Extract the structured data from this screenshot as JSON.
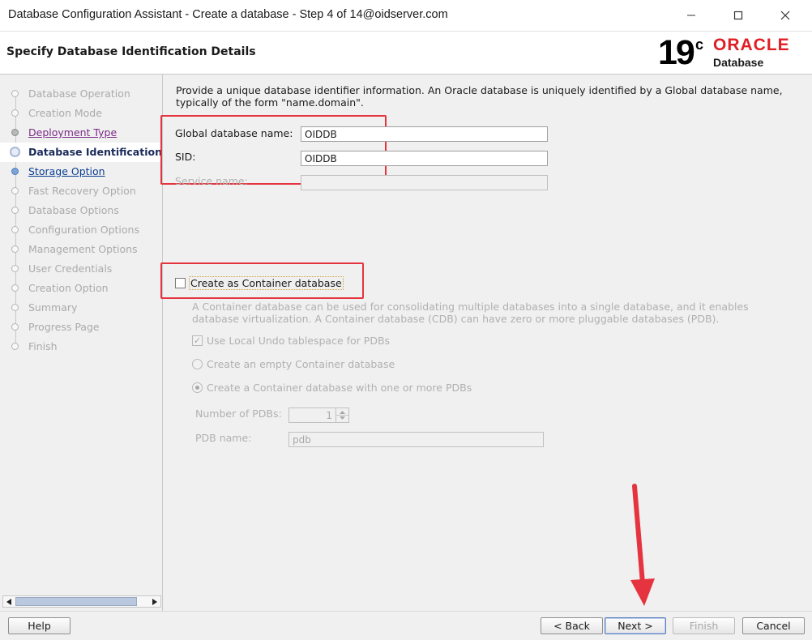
{
  "window": {
    "title": "Database Configuration Assistant - Create a database - Step 4 of 14@oidserver.com",
    "minimize_glyph": "—",
    "maximize_glyph": "☐",
    "close_glyph": "✕"
  },
  "header": {
    "page_title": "Specify Database Identification Details",
    "version_number": "19",
    "version_suffix": "c",
    "brand": "ORACLE",
    "product": "Database",
    "brand_color": "#e01f25"
  },
  "nav": {
    "steps": [
      {
        "label": "Database Operation",
        "state": "disabled"
      },
      {
        "label": "Creation Mode",
        "state": "disabled"
      },
      {
        "label": "Deployment Type",
        "state": "visited"
      },
      {
        "label": "Database Identification",
        "state": "current"
      },
      {
        "label": "Storage Option",
        "state": "link"
      },
      {
        "label": "Fast Recovery Option",
        "state": "disabled"
      },
      {
        "label": "Database Options",
        "state": "disabled"
      },
      {
        "label": "Configuration Options",
        "state": "disabled"
      },
      {
        "label": "Management Options",
        "state": "disabled"
      },
      {
        "label": "User Credentials",
        "state": "disabled"
      },
      {
        "label": "Creation Option",
        "state": "disabled"
      },
      {
        "label": "Summary",
        "state": "disabled"
      },
      {
        "label": "Progress Page",
        "state": "disabled"
      },
      {
        "label": "Finish",
        "state": "disabled"
      }
    ]
  },
  "main": {
    "description": "Provide a unique database identifier information. An Oracle database is uniquely identified by a Global database name, typically of the form \"name.domain\".",
    "global_db_label": "Global database name:",
    "global_db_value": "OIDDB",
    "sid_label": "SID:",
    "sid_value": "OIDDB",
    "service_label": "Service name:",
    "service_value": "",
    "cdb_label": "Create as Container database",
    "cdb_checked": false,
    "cdb_description": "A Container database can be used for consolidating multiple databases into a single database, and it enables database virtualization. A Container database (CDB) can have zero or more pluggable databases (PDB).",
    "undo_label": "Use Local Undo tablespace for PDBs",
    "undo_checked": true,
    "empty_cdb_label": "Create an empty Container database",
    "cdb_with_pdbs_label": "Create a Container database with one or more PDBs",
    "selected_option": "cdb_with_pdbs",
    "num_pdbs_label": "Number of PDBs:",
    "num_pdbs_value": "1",
    "pdb_name_label": "PDB name:",
    "pdb_name_value": "pdb",
    "annotation_color": "#e5343f"
  },
  "footer": {
    "help": "Help",
    "back": "< Back",
    "next": "Next >",
    "finish": "Finish",
    "cancel": "Cancel"
  }
}
